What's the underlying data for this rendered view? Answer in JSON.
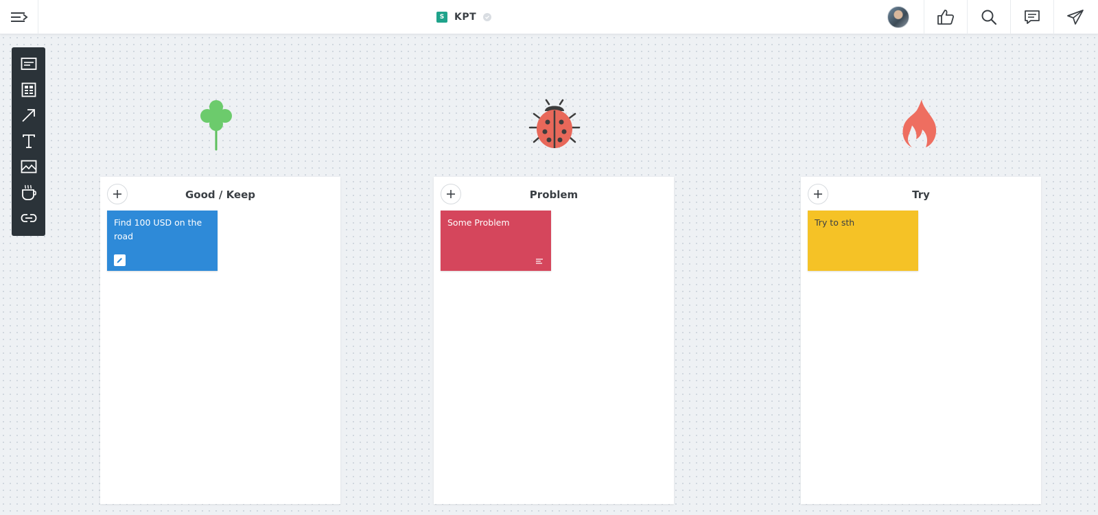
{
  "header": {
    "board_badge": "S",
    "board_name": "KPT"
  },
  "toolbar": {
    "tools": [
      "card-tool-icon",
      "template-tool-icon",
      "arrow-tool-icon",
      "text-tool-icon",
      "image-tool-icon",
      "cup-tool-icon",
      "link-tool-icon"
    ]
  },
  "columns": [
    {
      "title": "Good / Keep",
      "icon": "clover-icon",
      "card": {
        "text": "Find 100 USD on the road",
        "color": "#2e8ad8",
        "text_color": "#ffffff",
        "foot_icon": "edit-icon"
      }
    },
    {
      "title": "Problem",
      "icon": "ladybug-icon",
      "card": {
        "text": "Some Problem",
        "color": "#d5465c",
        "text_color": "#ffffff",
        "foot_icon": "note-lines-icon"
      }
    },
    {
      "title": "Try",
      "icon": "flame-icon",
      "card": {
        "text": "Try to sth",
        "color": "#f5c226",
        "text_color": "#3a3f44",
        "foot_icon": ""
      }
    }
  ],
  "colors": {
    "accent": "#1fa38b",
    "toolbar_bg": "#2b3339",
    "clover": "#6ccb6c",
    "ladybug": "#e8685a",
    "flame": "#ee6e60"
  }
}
